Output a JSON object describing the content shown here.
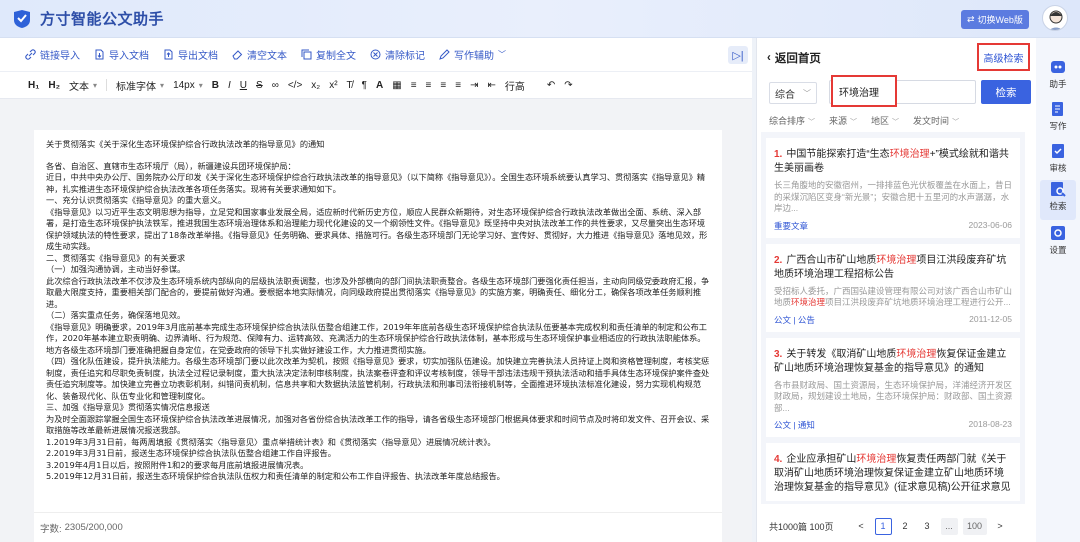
{
  "app": {
    "title": "方寸智能公文助手",
    "switch_web": "切换Web版"
  },
  "toolbar": {
    "items": [
      "链接导入",
      "导入文档",
      "导出文档",
      "清空文本",
      "复制全文",
      "清除标记",
      "写作辅助"
    ]
  },
  "format": {
    "h1": "H₁",
    "h2": "H₂",
    "paragraph": "文本",
    "font": "标准字体",
    "size": "14px",
    "line_height": "行高"
  },
  "document": {
    "title": "关于贯彻落实《关于深化生态环境保护综合行政执法改革的指导意见》的通知",
    "paragraphs": [
      "各省、自治区、直辖市生态环境厅（局），新疆建设兵团环境保护局：",
      "近日，中共中央办公厅、国务院办公厅印发《关于深化生态环境保护综合行政执法改革的指导意见》（以下简称《指导意见》）。全国生态环境系统要认真学习、贯彻落实《指导意见》精神，扎实推进生态环境保护综合执法改革各项任务落实。现将有关要求通知如下。",
      "一、充分认识贯彻落实《指导意见》的重大意义。",
      "《指导意见》以习近平生态文明思想为指导，立足党和国家事业发展全局，适应新时代新历史方位，顺应人民群众新期待，对生态环境保护综合行政执法改革做出全面、系统、深入部署，是打造生态环境保护执法铁军，推进我国生态环境治理体系和治理能力现代化建设的又一个纲领性文件。《指导意见》既坚持中央对执法改革工作的共性要求，又尽量突出生态环境保护领域执法的特性要求，提出了18条改革举措。《指导意见》任务明确、要求具体、措施可行。各级生态环境部门无论学习好、宣传好、贯彻好，大力推进《指导意见》落地见效，形成生动实践。",
      "二、贯彻落实《指导意见》的有关要求",
      "（一）加强沟通协调，主动当好参谋。",
      "此次综合行政执法改革不仅涉及生态环境系统内部纵向的层级执法职责调整，也涉及外部横向的部门间执法职责整合。各级生态环境部门要强化责任担当，主动向同级党委政府汇报，争取最大限度支持，重要相关部门配合的，要提前做好沟通。要根据本地实际情况，向同级政府提出贯彻落实《指导意见》的实施方案，明确责任、细化分工，确保各项改革任务顺利推进。",
      "（二）落实重点任务，确保落地见效。",
      "《指导意见》明确要求，2019年3月底前基本完成生态环境保护综合执法队伍整合组建工作，2019年年底前各级生态环境保护综合执法队伍要基本完成权利和责任清单的制定和公布工作，2020年基本建立职责明确、边界清晰、行为规范、保障有力、运转高效、充满活力的生态环境保护综合行政执法体制，基本形成与生态环境保护事业相适应的行政执法职能体系。地方各级生态环境部门要准确把握自身定位，在党委政府的领导下扎实做好建设工作，大力推进贯彻实施。",
      "（四）强化队伍建设，提升执法能力。各级生态环境部门要以此次改革为契机，按照《指导意见》要求，切实加强队伍建设。加快建立完善执法人员持证上岗和资格管理制度，考核奖惩制度，责任追究和尽职免责制度，执法全过程记录制度，重大执法决定法制审核制度，执法案卷评查和评议考核制度，领导干部违法违规干预执法活动和插手具体生态环境保护案件查处责任追究制度等。加快建立完善立功表彰机制，纠错问责机制，信息共享和大数据执法监管机制，行政执法和刑事司法衔接机制等，全面推进环境执法标准化建设，努力实现机构规范化、装备现代化、队伍专业化和管理制度化。",
      "三、加强《指导意见》贯彻落实情况信息报送",
      "为及时全面跟踪掌握全国生态环境保护综合执法改革进展情况，加强对各省份综合执法改革工作的指导，请各省级生态环境部门根据具体要求和时间节点及时将印发文件、召开会议、采取措施等改革最新进展情况报送我部。",
      "1.2019年3月31日前，每两周填报《贯彻落实〈指导意见〉重点举措统计表》和《贯彻落实〈指导意见〉进展情况统计表》。",
      "2.2019年3月31日前，报送生态环境保护综合执法队伍整合组建工作自评报告。",
      "3.2019年4月1日以后，按照附件1和2的要求每月底前填报进展情况表。",
      "5.2019年12月31日前，报送生态环境保护综合执法队伍权力和责任清单的制定和公布工作自评报告、执法改革年度总结报告。"
    ],
    "word_count_label": "字数:",
    "word_count": "2305/200,000"
  },
  "panel": {
    "back": "返回首页",
    "advanced": "高级检索",
    "scope": "综合",
    "query": "环境治理",
    "search_btn": "检索",
    "filters": [
      "综合排序",
      "来源",
      "地区",
      "发文时间"
    ],
    "results": [
      {
        "num": "1.",
        "title_a": "中国节能探索打造“生态",
        "title_hl": "环境治理",
        "title_b": "+”模式绘就和谐共生美丽画卷",
        "desc_a": "长三角腹地的安徽宿州，一排排蓝色光伏板覆盖在水面上，昔日的采煤沉陷区变身“新光景”；安徽合肥十五里河的水声潺潺，水岸边...",
        "desc_hl": "",
        "desc_b": "",
        "tag": "重要文章",
        "date": "2023-06-06"
      },
      {
        "num": "2.",
        "title_a": "广西合山市矿山地质",
        "title_hl": "环境治理",
        "title_b": "项目江洪段废弃矿坑地质环境治理工程招标公告",
        "desc_a": "受招标人委托，广西国弘建设管理有限公司对该广西合山市矿山地质",
        "desc_hl": "环境治理",
        "desc_b": "项目江洪段废弃矿坑地质环境治理工程进行公开...",
        "tag": "公文 | 公告",
        "date": "2011-12-05"
      },
      {
        "num": "3.",
        "title_a": "关于转发《取消矿山地质",
        "title_hl": "环境治理",
        "title_b": "恢复保证金建立矿山地质环境治理恢复基金的指导意见》的通知",
        "desc_a": "各市县财政局、国土资源局，生态环境保护局，洋浦经济开发区财政局，规划建设土地局，生态环境保护局：财政部、国土资源部...",
        "desc_hl": "",
        "desc_b": "",
        "tag": "公文 | 通知",
        "date": "2018-08-23"
      },
      {
        "num": "4.",
        "title_a": "企业应承担矿山",
        "title_hl": "环境治理",
        "title_b": "恢复责任两部门就《关于取消矿山地质环境治理恢复保证金建立矿山地质环境治理恢复基金的指导意见》(征求意见稿)公开征求意见",
        "desc_a": "",
        "desc_hl": "",
        "desc_b": "",
        "tag": "",
        "date": ""
      }
    ],
    "pager": {
      "total": "共1000篇 100页",
      "prev": "<",
      "pages": [
        "1",
        "2",
        "3",
        "...",
        "100"
      ],
      "next": ">"
    }
  },
  "sidenav": [
    "助手",
    "写作",
    "审核",
    "检索",
    "设置"
  ],
  "colors": {
    "brand": "#2d4ea8",
    "accent": "#3a63e0",
    "highlight": "#e53935"
  }
}
